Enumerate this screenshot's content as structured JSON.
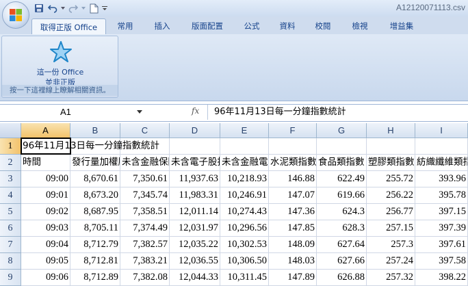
{
  "window": {
    "title": "A12120071113.csv"
  },
  "quick_access": {
    "icons": [
      "save-icon",
      "undo-icon",
      "redo-icon",
      "new-document-icon",
      "customize-icon"
    ]
  },
  "tabs": [
    {
      "label": "取得正版 Office",
      "active": true
    },
    {
      "label": "常用"
    },
    {
      "label": "插入"
    },
    {
      "label": "版面配置"
    },
    {
      "label": "公式"
    },
    {
      "label": "資料"
    },
    {
      "label": "校閱"
    },
    {
      "label": "檢視"
    },
    {
      "label": "增益集"
    }
  ],
  "ribbon": {
    "button_line1": "這一份 Office",
    "button_line2": "並非正版",
    "group_label": "按一下這裡線上瞭解相關資訊。"
  },
  "formula_bar": {
    "name_box": "A1",
    "fx_label": "fx",
    "value": "96年11月13日每一分鐘指數統計"
  },
  "grid": {
    "columns": [
      "A",
      "B",
      "C",
      "D",
      "E",
      "F",
      "G",
      "H",
      "I"
    ],
    "selected_column": "A",
    "selected_row": "1",
    "rows": [
      {
        "num": "1",
        "cells": [
          "96年11月13日每一分鐘指數統計",
          "",
          "",
          "",
          "",
          "",
          "",
          "",
          ""
        ]
      },
      {
        "num": "2",
        "cells": [
          "時間",
          "發行量加權股價指數",
          "未含金融保險股指數",
          "未含電子股指數",
          "未含金融電子股指數",
          "水泥類指數",
          "食品類指數",
          "塑膠類指數",
          "紡織纖維類指數"
        ]
      },
      {
        "num": "3",
        "cells": [
          "09:00",
          "8,670.61",
          "7,350.61",
          "11,937.63",
          "10,218.93",
          "146.88",
          "622.49",
          "255.72",
          "393.96"
        ]
      },
      {
        "num": "4",
        "cells": [
          "09:01",
          "8,673.20",
          "7,345.74",
          "11,983.31",
          "10,246.91",
          "147.07",
          "619.66",
          "256.22",
          "395.78"
        ]
      },
      {
        "num": "5",
        "cells": [
          "09:02",
          "8,687.95",
          "7,358.51",
          "12,011.14",
          "10,274.43",
          "147.36",
          "624.3",
          "256.77",
          "397.15"
        ]
      },
      {
        "num": "6",
        "cells": [
          "09:03",
          "8,705.11",
          "7,374.49",
          "12,031.97",
          "10,296.56",
          "147.85",
          "628.3",
          "257.15",
          "397.39"
        ]
      },
      {
        "num": "7",
        "cells": [
          "09:04",
          "8,712.79",
          "7,382.57",
          "12,035.22",
          "10,302.53",
          "148.09",
          "627.64",
          "257.3",
          "397.61"
        ]
      },
      {
        "num": "8",
        "cells": [
          "09:05",
          "8,712.81",
          "7,383.21",
          "12,036.55",
          "10,306.50",
          "148.03",
          "627.66",
          "257.24",
          "397.58"
        ]
      },
      {
        "num": "9",
        "cells": [
          "09:06",
          "8,712.89",
          "7,382.08",
          "12,044.33",
          "10,311.45",
          "147.89",
          "626.88",
          "257.32",
          "398.22"
        ]
      }
    ]
  }
}
